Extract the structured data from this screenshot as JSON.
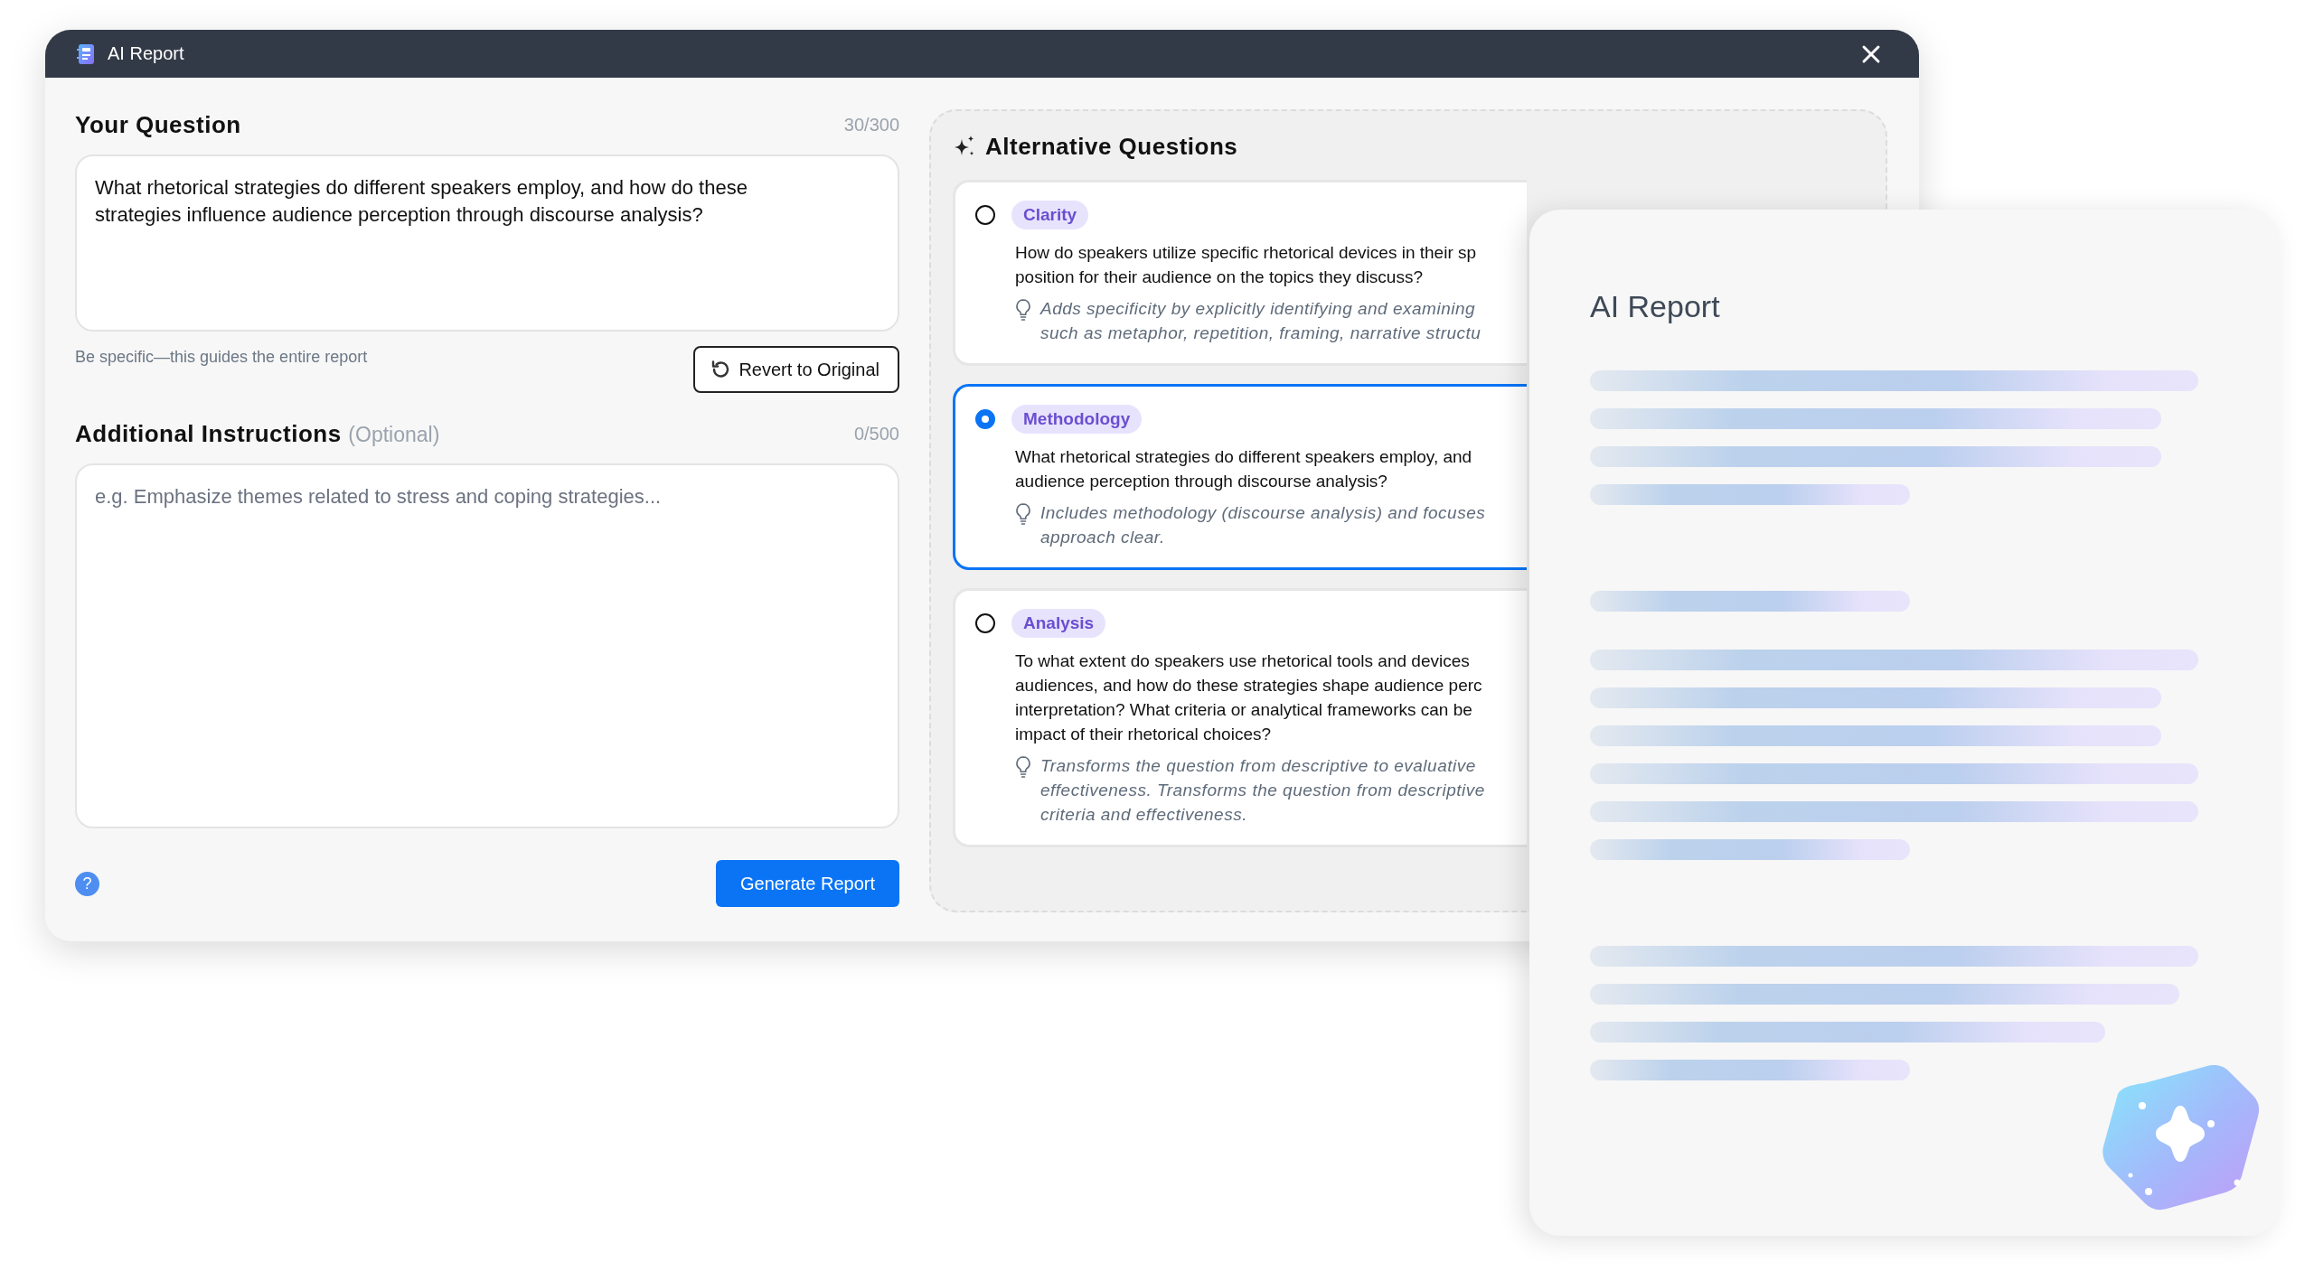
{
  "window": {
    "title": "AI Report"
  },
  "question": {
    "heading": "Your Question",
    "counter": "30/300",
    "value": "What rhetorical strategies do different speakers employ, and how do these strategies influence audience perception through discourse analysis?",
    "hint": "Be specific—this guides the entire report",
    "revert_button": "Revert to Original"
  },
  "instructions": {
    "heading": "Additional Instructions",
    "optional_label": "(Optional)",
    "counter": "0/500",
    "placeholder": "e.g. Emphasize themes related to stress and coping strategies..."
  },
  "help_button": "?",
  "generate_button": "Generate Report",
  "alternatives": {
    "heading": "Alternative Questions",
    "items": [
      {
        "tag": "Clarity",
        "selected": false,
        "question_lines": [
          "How do speakers utilize specific rhetorical devices in their sp",
          "position for their audience on the topics they discuss?"
        ],
        "note_lines": [
          "Adds specificity by explicitly identifying and examining",
          "such as metaphor, repetition, framing, narrative structu"
        ]
      },
      {
        "tag": "Methodology",
        "selected": true,
        "question_lines": [
          "What rhetorical strategies do different speakers employ, and",
          "audience perception through discourse analysis?"
        ],
        "note_lines": [
          "Includes methodology (discourse analysis) and focuses",
          "approach clear."
        ]
      },
      {
        "tag": "Analysis",
        "selected": false,
        "question_lines": [
          "To what extent do speakers use rhetorical tools and devices",
          "audiences, and how do these strategies shape audience perc",
          "interpretation? What criteria or analytical frameworks can be",
          "impact of their rhetorical choices?"
        ],
        "note_lines": [
          "Transforms the question from descriptive to evaluative",
          "effectiveness. Transforms the question from descriptive",
          "criteria and effectiveness."
        ]
      }
    ]
  },
  "report_preview": {
    "title": "AI Report"
  }
}
